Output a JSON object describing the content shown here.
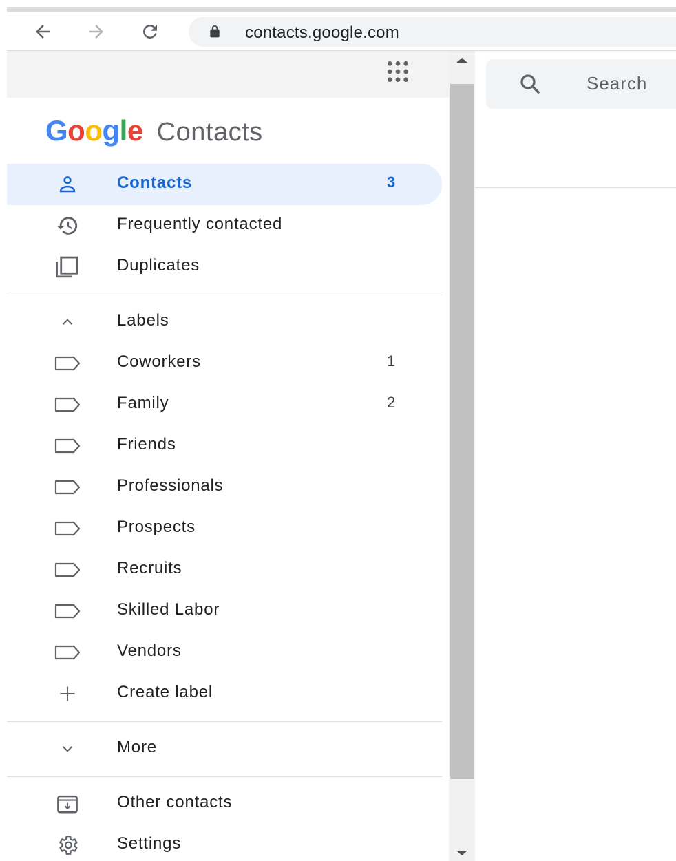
{
  "browser": {
    "url": "contacts.google.com"
  },
  "app": {
    "logo_text": "Google",
    "product_name": "Contacts"
  },
  "sidebar": {
    "main_items": [
      {
        "label": "Contacts",
        "count": "3",
        "icon": "person-icon",
        "active": true
      },
      {
        "label": "Frequently contacted",
        "count": "",
        "icon": "history-icon"
      },
      {
        "label": "Duplicates",
        "count": "",
        "icon": "duplicates-icon"
      }
    ],
    "labels_header": "Labels",
    "labels": [
      {
        "label": "Coworkers",
        "count": "1"
      },
      {
        "label": "Family",
        "count": "2"
      },
      {
        "label": "Friends",
        "count": ""
      },
      {
        "label": "Professionals",
        "count": ""
      },
      {
        "label": "Prospects",
        "count": ""
      },
      {
        "label": "Recruits",
        "count": ""
      },
      {
        "label": "Skilled Labor",
        "count": ""
      },
      {
        "label": "Vendors",
        "count": ""
      }
    ],
    "create_label": "Create label",
    "more": "More",
    "other_contacts": "Other contacts",
    "settings": "Settings"
  },
  "search": {
    "placeholder": "Search"
  },
  "colors": {
    "accent": "#1967d2",
    "active_bg": "#e8f0fe",
    "google_blue": "#4285f4",
    "google_red": "#ea4335",
    "google_yellow": "#fbbc05",
    "google_green": "#34a853"
  }
}
